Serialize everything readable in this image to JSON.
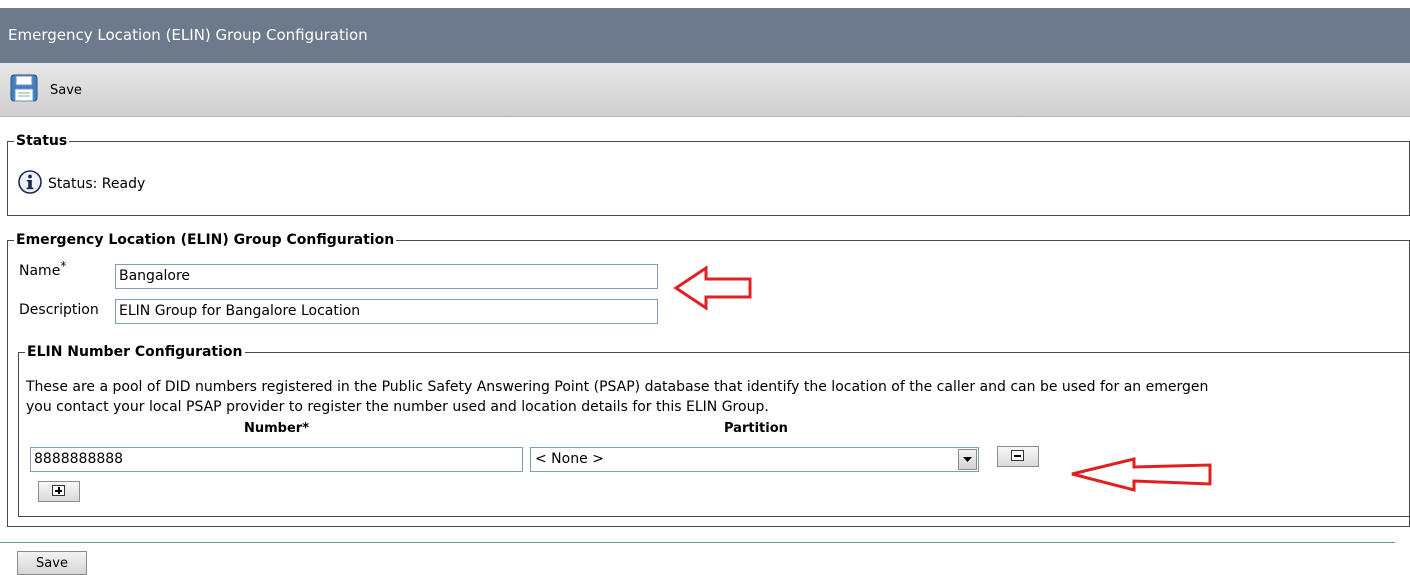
{
  "window": {
    "title": "Emergency Location (ELIN) Group Configuration"
  },
  "toolbar": {
    "save_label": "Save",
    "save_icon": "floppy-disk-icon"
  },
  "status_section": {
    "legend": "Status",
    "status_icon": "info-icon",
    "status_text": "Status: Ready"
  },
  "elin_group": {
    "legend": "Emergency Location (ELIN) Group Configuration",
    "name_label": "Name",
    "name_required_marker": "*",
    "name_value": "Bangalore",
    "description_label": "Description",
    "description_value": "ELIN Group for Bangalore Location"
  },
  "elin_numbers": {
    "legend": "ELIN Number Configuration",
    "description_line1": "These are a pool of DID numbers registered in the Public Safety Answering Point (PSAP) database that identify the location of the caller and can be used for an emergen",
    "description_line2": "you contact your local PSAP provider to register the number used and location details for this ELIN Group.",
    "number_header": "Number*",
    "partition_header": "Partition",
    "rows": [
      {
        "number": "8888888888",
        "partition": "< None >"
      }
    ],
    "remove_icon": "minus-icon",
    "add_icon": "plus-icon"
  },
  "footer": {
    "save_label": "Save"
  },
  "colors": {
    "title_bar": "#6c7a8b",
    "annotation_arrow": "#e02020"
  }
}
